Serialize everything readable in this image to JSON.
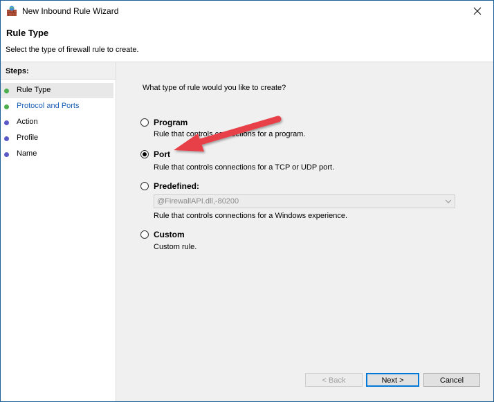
{
  "window": {
    "title": "New Inbound Rule Wizard",
    "close_glyph": "✕"
  },
  "header": {
    "title": "Rule Type",
    "subtitle": "Select the type of firewall rule to create."
  },
  "sidebar": {
    "title": "Steps:",
    "items": [
      {
        "label": "Rule Type",
        "dot_color": "#4cae4c",
        "active": true
      },
      {
        "label": "Protocol and Ports",
        "dot_color": "#4cae4c",
        "active": false
      },
      {
        "label": "Action",
        "dot_color": "#5b5bc8",
        "active": false
      },
      {
        "label": "Profile",
        "dot_color": "#5b5bc8",
        "active": false
      },
      {
        "label": "Name",
        "dot_color": "#5b5bc8",
        "active": false
      }
    ]
  },
  "main": {
    "question": "What type of rule would you like to create?",
    "options": [
      {
        "label": "Program",
        "description": "Rule that controls connections for a program.",
        "selected": false
      },
      {
        "label": "Port",
        "description": "Rule that controls connections for a TCP or UDP port.",
        "selected": true
      },
      {
        "label": "Predefined:",
        "description": "Rule that controls connections for a Windows experience.",
        "selected": false
      },
      {
        "label": "Custom",
        "description": "Custom rule.",
        "selected": false
      }
    ],
    "predefined_combo_value": "@FirewallAPI.dll,-80200"
  },
  "buttons": {
    "back": "< Back",
    "next": "Next >",
    "cancel": "Cancel"
  },
  "colors": {
    "accent": "#0078d7",
    "annotation_arrow": "#e8404a",
    "link_step": "#1a5fb4"
  }
}
